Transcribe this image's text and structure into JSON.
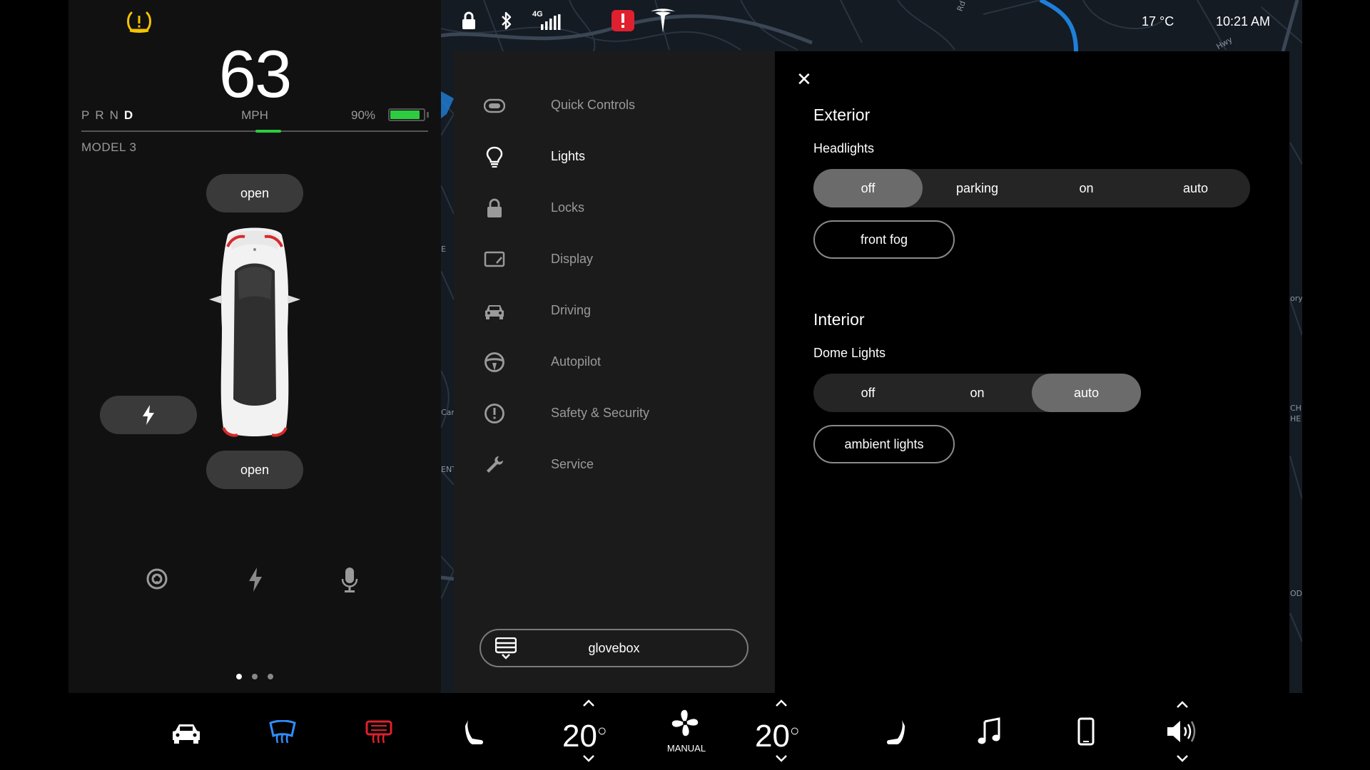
{
  "vehicle": {
    "speed": "63",
    "speed_unit": "MPH",
    "gears": [
      "P",
      "R",
      "N",
      "D"
    ],
    "active_gear": "D",
    "battery_pct_label": "90%",
    "battery_level": 0.9,
    "model_name": "MODEL 3",
    "frunk_label": "open",
    "trunk_label": "open",
    "page_dots": 3,
    "active_page": 0
  },
  "status_bar": {
    "outside_temp": "17 °C",
    "time": "10:21 AM",
    "network": "4G"
  },
  "map": {
    "labels": [
      "Car",
      "E",
      "ENT",
      "ory",
      "CH",
      "HE",
      "OD",
      "Rd",
      "Hwy"
    ]
  },
  "settings_menu": {
    "items": [
      {
        "label": "Quick Controls",
        "icon": "toggle-icon"
      },
      {
        "label": "Lights",
        "icon": "lightbulb-icon"
      },
      {
        "label": "Locks",
        "icon": "lock-icon"
      },
      {
        "label": "Display",
        "icon": "display-icon"
      },
      {
        "label": "Driving",
        "icon": "car-front-icon"
      },
      {
        "label": "Autopilot",
        "icon": "steering-wheel-icon"
      },
      {
        "label": "Safety & Security",
        "icon": "alert-circle-icon"
      },
      {
        "label": "Service",
        "icon": "wrench-icon"
      }
    ],
    "active": "Lights",
    "glovebox_label": "glovebox"
  },
  "lights": {
    "exterior_title": "Exterior",
    "headlights_label": "Headlights",
    "headlight_options": [
      "off",
      "parking",
      "on",
      "auto"
    ],
    "headlight_selected": "off",
    "front_fog_label": "front fog",
    "interior_title": "Interior",
    "dome_label": "Dome Lights",
    "dome_options": [
      "off",
      "on",
      "auto"
    ],
    "dome_selected": "auto",
    "ambient_label": "ambient lights"
  },
  "dock": {
    "driver_temp": "20",
    "passenger_temp": "20",
    "fan_mode": "MANUAL",
    "colors": {
      "front_defrost": "#2f8fff",
      "rear_defrost": "#e0202e",
      "accent_green": "#2ecc40",
      "alert_red": "#e0202e",
      "tpms_yellow": "#f5c400"
    }
  }
}
